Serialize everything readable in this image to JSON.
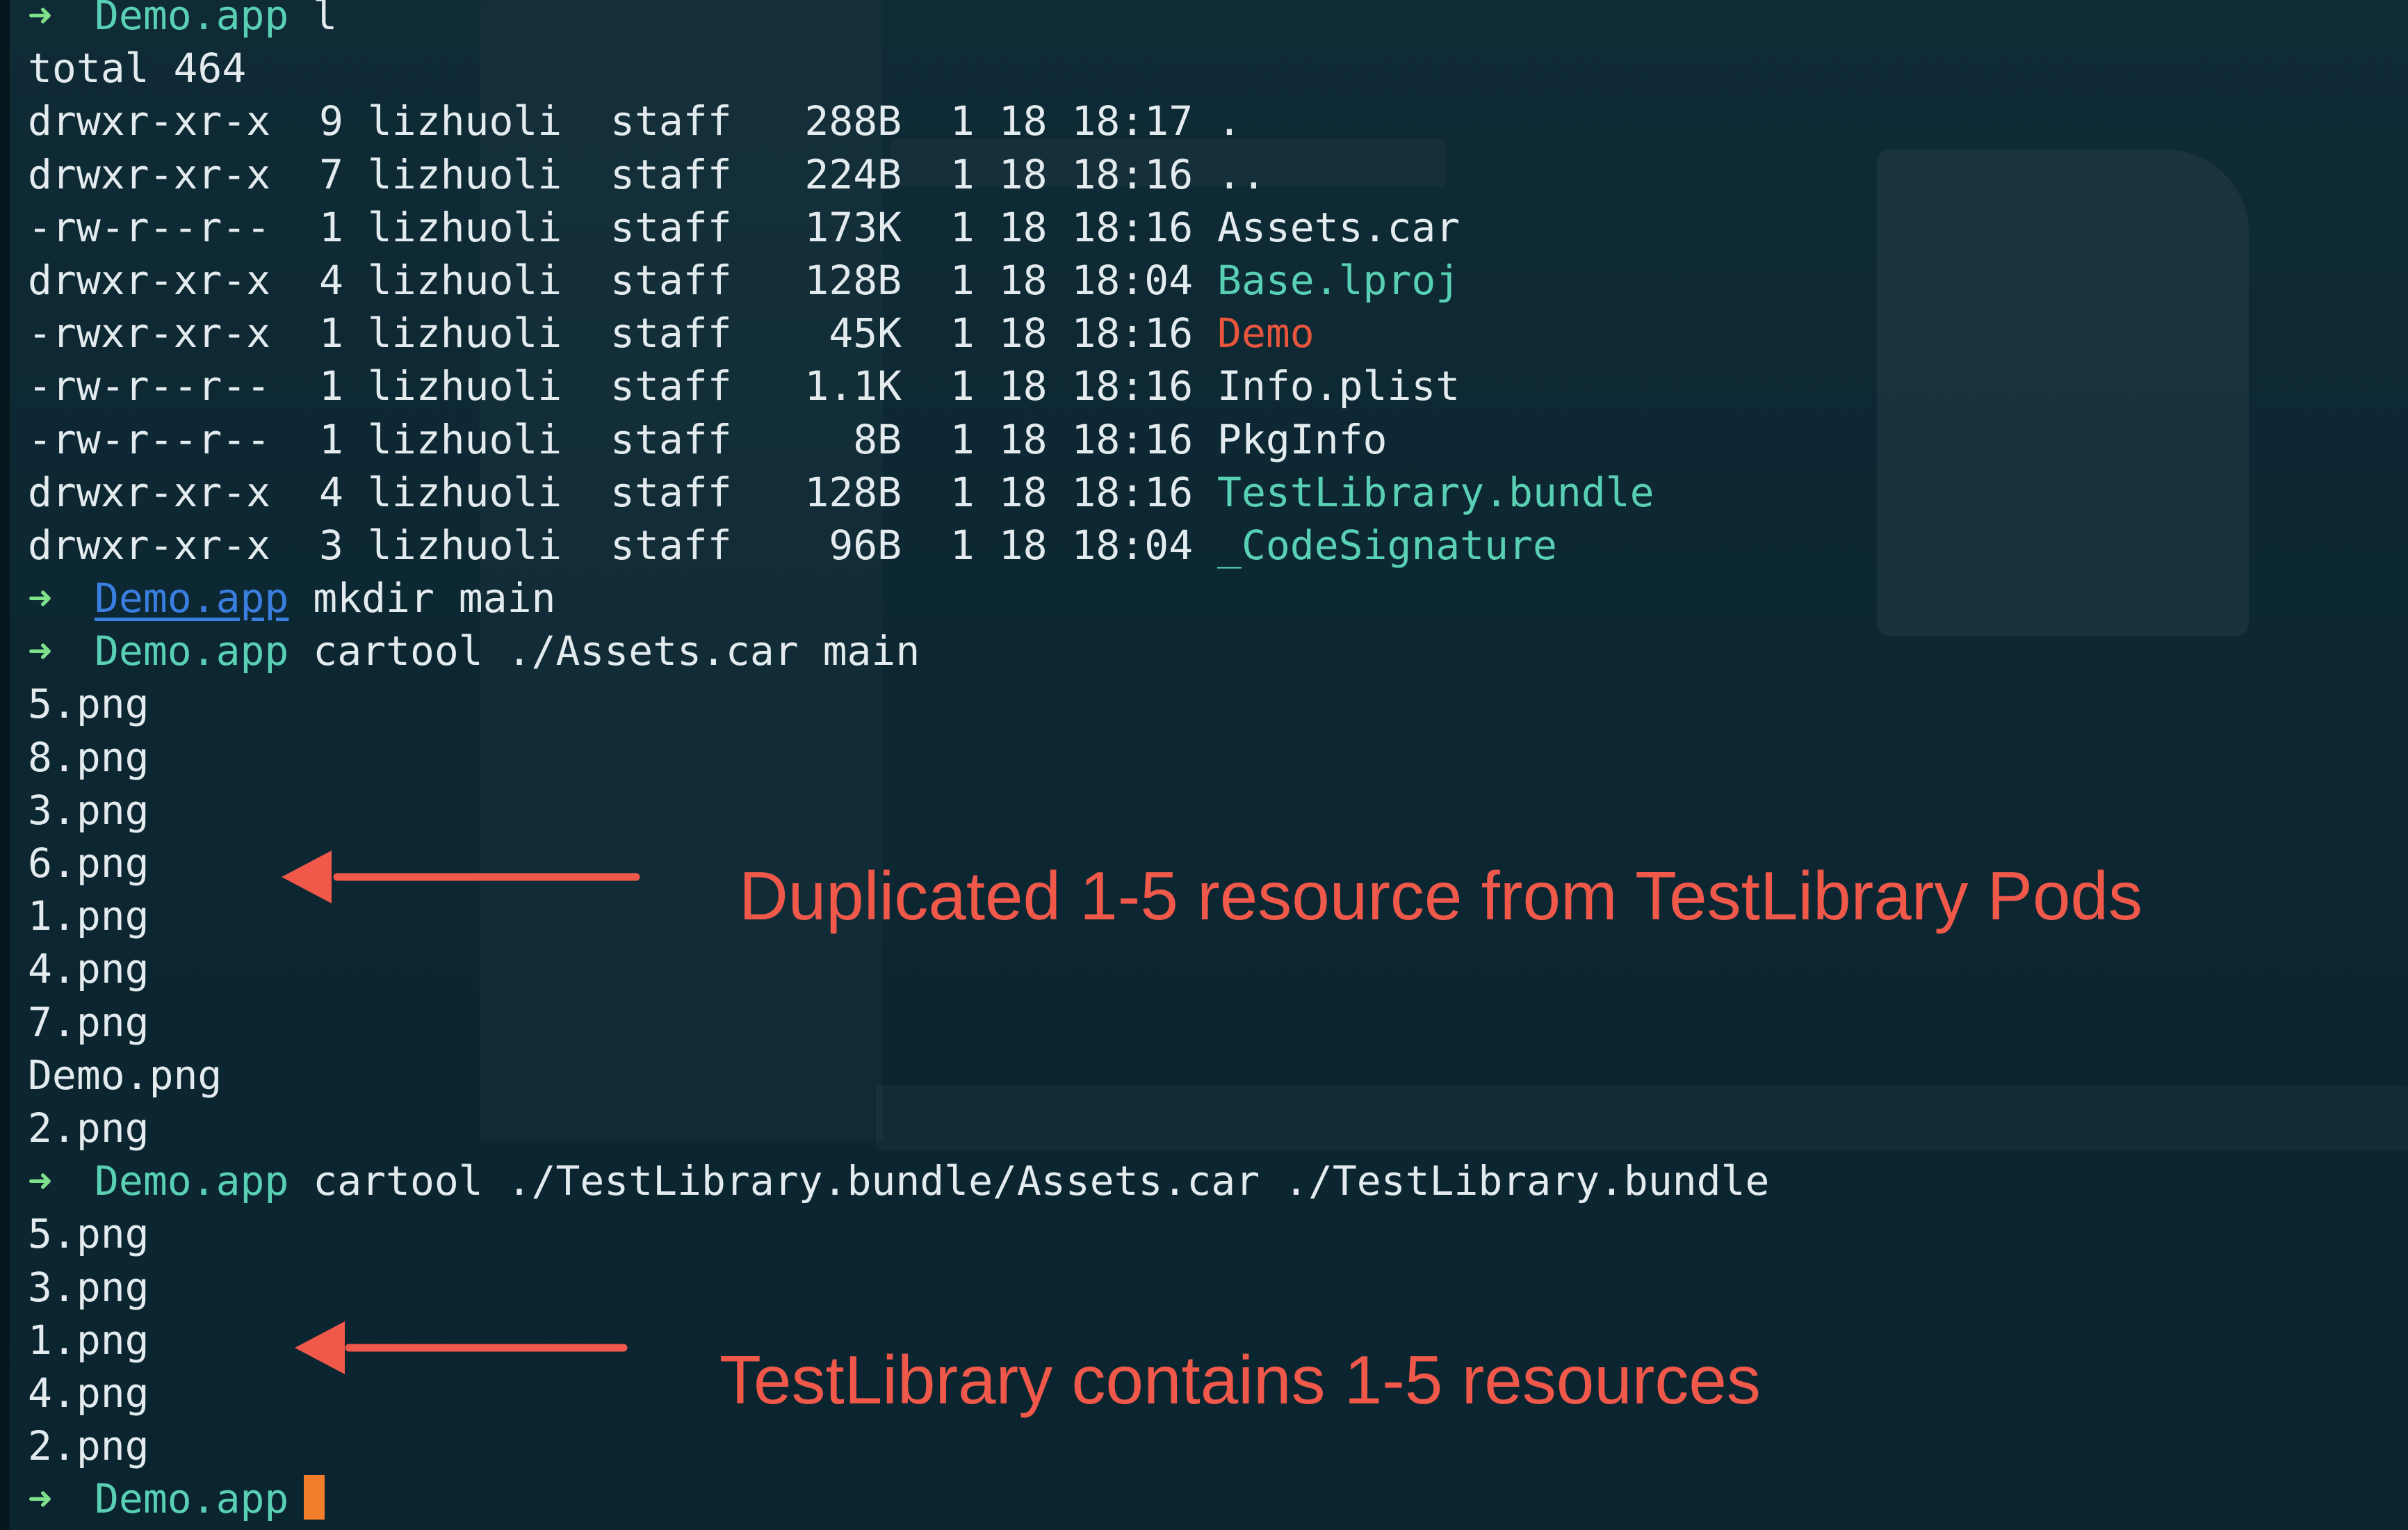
{
  "terminal": {
    "prompt_symbol": "➜",
    "cursor_color": "#f27d2a",
    "colors": {
      "background": "#0c2732",
      "text": "#e3ebee",
      "prompt_arrow": "#7fe08a",
      "directory": "#59d0b3",
      "executable": "#e7553c",
      "annotation": "#f0584a"
    },
    "lines": [
      {
        "type": "prompt",
        "dir": "Demo.app",
        "cmd": "l",
        "dir_link": false
      },
      {
        "type": "text",
        "text": "total 464"
      },
      {
        "type": "ls",
        "prefix": "drwxr-xr-x  9 lizhuoli  staff   288B  1 18 18:17 ",
        "name": ".",
        "kind": "plain"
      },
      {
        "type": "ls",
        "prefix": "drwxr-xr-x  7 lizhuoli  staff   224B  1 18 18:16 ",
        "name": "..",
        "kind": "plain"
      },
      {
        "type": "ls",
        "prefix": "-rw-r--r--  1 lizhuoli  staff   173K  1 18 18:16 ",
        "name": "Assets.car",
        "kind": "plain"
      },
      {
        "type": "ls",
        "prefix": "drwxr-xr-x  4 lizhuoli  staff   128B  1 18 18:04 ",
        "name": "Base.lproj",
        "kind": "dir"
      },
      {
        "type": "ls",
        "prefix": "-rwxr-xr-x  1 lizhuoli  staff    45K  1 18 18:16 ",
        "name": "Demo",
        "kind": "exec"
      },
      {
        "type": "ls",
        "prefix": "-rw-r--r--  1 lizhuoli  staff   1.1K  1 18 18:16 ",
        "name": "Info.plist",
        "kind": "plain"
      },
      {
        "type": "ls",
        "prefix": "-rw-r--r--  1 lizhuoli  staff     8B  1 18 18:16 ",
        "name": "PkgInfo",
        "kind": "plain"
      },
      {
        "type": "ls",
        "prefix": "drwxr-xr-x  4 lizhuoli  staff   128B  1 18 18:16 ",
        "name": "TestLibrary.bundle",
        "kind": "dir"
      },
      {
        "type": "ls",
        "prefix": "drwxr-xr-x  3 lizhuoli  staff    96B  1 18 18:04 ",
        "name": "_CodeSignature",
        "kind": "dir"
      },
      {
        "type": "prompt",
        "dir": "Demo.app",
        "cmd": "mkdir main",
        "dir_link": true
      },
      {
        "type": "prompt",
        "dir": "Demo.app",
        "cmd": "cartool ./Assets.car main",
        "dir_link": false
      },
      {
        "type": "text",
        "text": "5.png"
      },
      {
        "type": "text",
        "text": "8.png"
      },
      {
        "type": "text",
        "text": "3.png"
      },
      {
        "type": "text",
        "text": "6.png"
      },
      {
        "type": "text",
        "text": "1.png"
      },
      {
        "type": "text",
        "text": "4.png"
      },
      {
        "type": "text",
        "text": "7.png"
      },
      {
        "type": "text",
        "text": "Demo.png"
      },
      {
        "type": "text",
        "text": "2.png"
      },
      {
        "type": "prompt",
        "dir": "Demo.app",
        "cmd": "cartool ./TestLibrary.bundle/Assets.car ./TestLibrary.bundle",
        "dir_link": false
      },
      {
        "type": "text",
        "text": "5.png"
      },
      {
        "type": "text",
        "text": "3.png"
      },
      {
        "type": "text",
        "text": "1.png"
      },
      {
        "type": "text",
        "text": "4.png"
      },
      {
        "type": "text",
        "text": "2.png"
      },
      {
        "type": "prompt",
        "dir": "Demo.app",
        "cmd": "",
        "dir_link": false,
        "cursor": true
      }
    ]
  },
  "annotations": [
    {
      "text": "Duplicated 1-5 resource from TestLibrary Pods"
    },
    {
      "text": "TestLibrary contains 1-5 resources"
    }
  ]
}
